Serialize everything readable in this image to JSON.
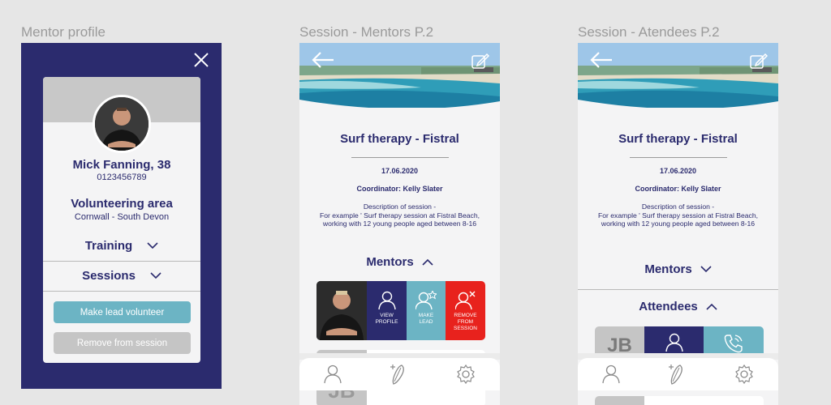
{
  "frames": {
    "mentor_profile": "Mentor profile",
    "session_mentors": "Session - Mentors P.2",
    "session_attendees": "Session - Atendees P.2"
  },
  "mentor_profile": {
    "name": "Mick Fanning, 38",
    "phone": "0123456789",
    "area_title": "Volunteering area",
    "area_value": "Cornwall - South Devon",
    "training_label": "Training",
    "sessions_label": "Sessions",
    "make_lead_label": "Make lead volunteer",
    "remove_label": "Remove from session"
  },
  "session": {
    "title": "Surf therapy - Fistral",
    "date": "17.06.2020",
    "coordinator": "Coordinator: Kelly Slater",
    "description_lines": [
      "Description of session -",
      "For example ' Surf therapy session at Fistral Beach,",
      "working with 12 young people aged between 8-16"
    ],
    "mentors_label": "Mentors",
    "attendees_label": "Attendees"
  },
  "mentor_actions": {
    "view_profile": [
      "VIEW",
      "PROFILE"
    ],
    "make_lead": [
      "MAKE",
      "LEAD"
    ],
    "remove": [
      "REMOVE",
      "FROM",
      "SESSION"
    ]
  },
  "attendee": {
    "initials": "JB"
  },
  "next_mentor_initials": "JB",
  "colors": {
    "navy": "#2b2b6e",
    "teal": "#6cb4c4",
    "red": "#e8221d",
    "grey": "#c5c5c5"
  },
  "icons": {
    "close": "close-icon",
    "back": "back-arrow-icon",
    "edit": "edit-icon",
    "chevron_down": "chevron-down-icon",
    "chevron_up": "chevron-up-icon",
    "person": "person-icon",
    "surfboard": "surfboard-icon",
    "gear": "gear-icon",
    "phone": "phone-icon"
  }
}
